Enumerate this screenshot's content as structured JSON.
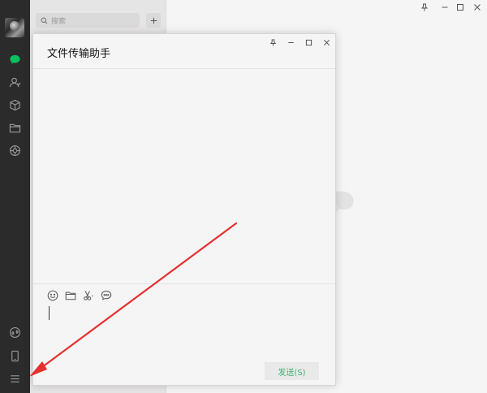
{
  "search": {
    "placeholder": "搜索"
  },
  "chat_window": {
    "title": "文件传输助手",
    "send_label": "发送(S)"
  },
  "icons": {
    "nav": [
      "chat-icon",
      "contacts-icon",
      "favorites-icon",
      "folder-icon",
      "moments-icon",
      "miniprogram-icon",
      "phone-icon",
      "menu-icon"
    ],
    "toolbar": [
      "emoji-icon",
      "folder-icon",
      "scissors-icon",
      "chat-history-icon"
    ]
  },
  "colors": {
    "nav_bg": "#2b2b2b",
    "active_green": "#07c160",
    "send_text": "#3cb371",
    "annotation_red": "#e53030"
  }
}
